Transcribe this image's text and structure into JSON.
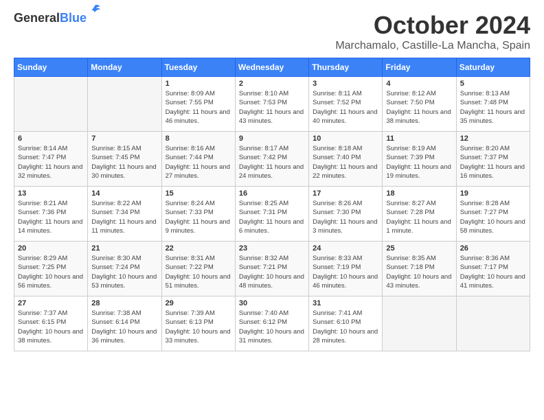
{
  "header": {
    "logo": {
      "general": "General",
      "blue": "Blue"
    },
    "month": "October 2024",
    "location": "Marchamalo, Castille-La Mancha, Spain"
  },
  "weekdays": [
    "Sunday",
    "Monday",
    "Tuesday",
    "Wednesday",
    "Thursday",
    "Friday",
    "Saturday"
  ],
  "weeks": [
    [
      {
        "day": "",
        "empty": true
      },
      {
        "day": "",
        "empty": true
      },
      {
        "day": "1",
        "sunrise": "Sunrise: 8:09 AM",
        "sunset": "Sunset: 7:55 PM",
        "daylight": "Daylight: 11 hours and 46 minutes."
      },
      {
        "day": "2",
        "sunrise": "Sunrise: 8:10 AM",
        "sunset": "Sunset: 7:53 PM",
        "daylight": "Daylight: 11 hours and 43 minutes."
      },
      {
        "day": "3",
        "sunrise": "Sunrise: 8:11 AM",
        "sunset": "Sunset: 7:52 PM",
        "daylight": "Daylight: 11 hours and 40 minutes."
      },
      {
        "day": "4",
        "sunrise": "Sunrise: 8:12 AM",
        "sunset": "Sunset: 7:50 PM",
        "daylight": "Daylight: 11 hours and 38 minutes."
      },
      {
        "day": "5",
        "sunrise": "Sunrise: 8:13 AM",
        "sunset": "Sunset: 7:48 PM",
        "daylight": "Daylight: 11 hours and 35 minutes."
      }
    ],
    [
      {
        "day": "6",
        "sunrise": "Sunrise: 8:14 AM",
        "sunset": "Sunset: 7:47 PM",
        "daylight": "Daylight: 11 hours and 32 minutes."
      },
      {
        "day": "7",
        "sunrise": "Sunrise: 8:15 AM",
        "sunset": "Sunset: 7:45 PM",
        "daylight": "Daylight: 11 hours and 30 minutes."
      },
      {
        "day": "8",
        "sunrise": "Sunrise: 8:16 AM",
        "sunset": "Sunset: 7:44 PM",
        "daylight": "Daylight: 11 hours and 27 minutes."
      },
      {
        "day": "9",
        "sunrise": "Sunrise: 8:17 AM",
        "sunset": "Sunset: 7:42 PM",
        "daylight": "Daylight: 11 hours and 24 minutes."
      },
      {
        "day": "10",
        "sunrise": "Sunrise: 8:18 AM",
        "sunset": "Sunset: 7:40 PM",
        "daylight": "Daylight: 11 hours and 22 minutes."
      },
      {
        "day": "11",
        "sunrise": "Sunrise: 8:19 AM",
        "sunset": "Sunset: 7:39 PM",
        "daylight": "Daylight: 11 hours and 19 minutes."
      },
      {
        "day": "12",
        "sunrise": "Sunrise: 8:20 AM",
        "sunset": "Sunset: 7:37 PM",
        "daylight": "Daylight: 11 hours and 16 minutes."
      }
    ],
    [
      {
        "day": "13",
        "sunrise": "Sunrise: 8:21 AM",
        "sunset": "Sunset: 7:36 PM",
        "daylight": "Daylight: 11 hours and 14 minutes."
      },
      {
        "day": "14",
        "sunrise": "Sunrise: 8:22 AM",
        "sunset": "Sunset: 7:34 PM",
        "daylight": "Daylight: 11 hours and 11 minutes."
      },
      {
        "day": "15",
        "sunrise": "Sunrise: 8:24 AM",
        "sunset": "Sunset: 7:33 PM",
        "daylight": "Daylight: 11 hours and 9 minutes."
      },
      {
        "day": "16",
        "sunrise": "Sunrise: 8:25 AM",
        "sunset": "Sunset: 7:31 PM",
        "daylight": "Daylight: 11 hours and 6 minutes."
      },
      {
        "day": "17",
        "sunrise": "Sunrise: 8:26 AM",
        "sunset": "Sunset: 7:30 PM",
        "daylight": "Daylight: 11 hours and 3 minutes."
      },
      {
        "day": "18",
        "sunrise": "Sunrise: 8:27 AM",
        "sunset": "Sunset: 7:28 PM",
        "daylight": "Daylight: 11 hours and 1 minute."
      },
      {
        "day": "19",
        "sunrise": "Sunrise: 8:28 AM",
        "sunset": "Sunset: 7:27 PM",
        "daylight": "Daylight: 10 hours and 58 minutes."
      }
    ],
    [
      {
        "day": "20",
        "sunrise": "Sunrise: 8:29 AM",
        "sunset": "Sunset: 7:25 PM",
        "daylight": "Daylight: 10 hours and 56 minutes."
      },
      {
        "day": "21",
        "sunrise": "Sunrise: 8:30 AM",
        "sunset": "Sunset: 7:24 PM",
        "daylight": "Daylight: 10 hours and 53 minutes."
      },
      {
        "day": "22",
        "sunrise": "Sunrise: 8:31 AM",
        "sunset": "Sunset: 7:22 PM",
        "daylight": "Daylight: 10 hours and 51 minutes."
      },
      {
        "day": "23",
        "sunrise": "Sunrise: 8:32 AM",
        "sunset": "Sunset: 7:21 PM",
        "daylight": "Daylight: 10 hours and 48 minutes."
      },
      {
        "day": "24",
        "sunrise": "Sunrise: 8:33 AM",
        "sunset": "Sunset: 7:19 PM",
        "daylight": "Daylight: 10 hours and 46 minutes."
      },
      {
        "day": "25",
        "sunrise": "Sunrise: 8:35 AM",
        "sunset": "Sunset: 7:18 PM",
        "daylight": "Daylight: 10 hours and 43 minutes."
      },
      {
        "day": "26",
        "sunrise": "Sunrise: 8:36 AM",
        "sunset": "Sunset: 7:17 PM",
        "daylight": "Daylight: 10 hours and 41 minutes."
      }
    ],
    [
      {
        "day": "27",
        "sunrise": "Sunrise: 7:37 AM",
        "sunset": "Sunset: 6:15 PM",
        "daylight": "Daylight: 10 hours and 38 minutes."
      },
      {
        "day": "28",
        "sunrise": "Sunrise: 7:38 AM",
        "sunset": "Sunset: 6:14 PM",
        "daylight": "Daylight: 10 hours and 36 minutes."
      },
      {
        "day": "29",
        "sunrise": "Sunrise: 7:39 AM",
        "sunset": "Sunset: 6:13 PM",
        "daylight": "Daylight: 10 hours and 33 minutes."
      },
      {
        "day": "30",
        "sunrise": "Sunrise: 7:40 AM",
        "sunset": "Sunset: 6:12 PM",
        "daylight": "Daylight: 10 hours and 31 minutes."
      },
      {
        "day": "31",
        "sunrise": "Sunrise: 7:41 AM",
        "sunset": "Sunset: 6:10 PM",
        "daylight": "Daylight: 10 hours and 28 minutes."
      },
      {
        "day": "",
        "empty": true
      },
      {
        "day": "",
        "empty": true
      }
    ]
  ]
}
